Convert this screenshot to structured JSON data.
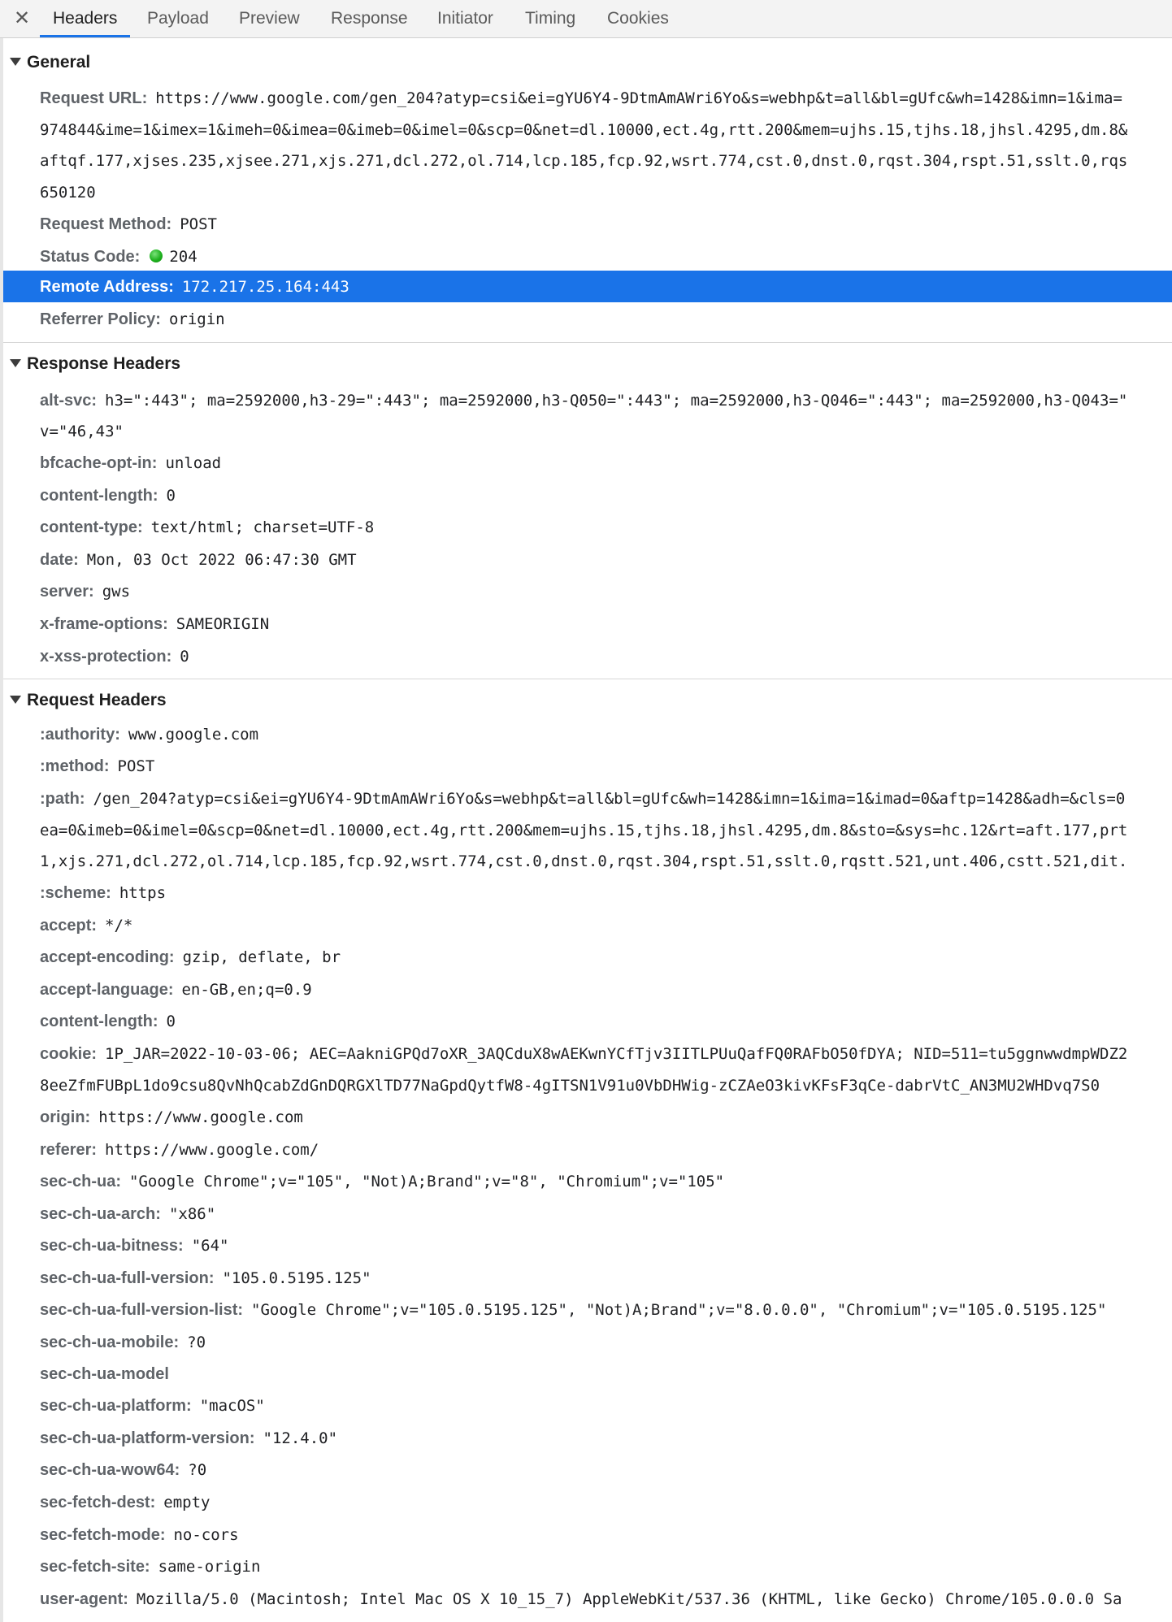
{
  "tabs": {
    "close_icon": "✕",
    "items": [
      "Headers",
      "Payload",
      "Preview",
      "Response",
      "Initiator",
      "Timing",
      "Cookies"
    ],
    "active": "Headers"
  },
  "general": {
    "title": "General",
    "request_url_key": "Request URL:",
    "request_url_lines": [
      "https://www.google.com/gen_204?atyp=csi&ei=gYU6Y4-9DtmAmAWri6Yo&s=webhp&t=all&bl=gUfc&wh=1428&imn=1&ima=",
      "974844&ime=1&imex=1&imeh=0&imea=0&imeb=0&imel=0&scp=0&net=dl.10000,ect.4g,rtt.200&mem=ujhs.15,tjhs.18,jhsl.4295,dm.8&",
      "aftqf.177,xjses.235,xjsee.271,xjs.271,dcl.272,ol.714,lcp.185,fcp.92,wsrt.774,cst.0,dnst.0,rqst.304,rspt.51,sslt.0,rqs",
      "650120"
    ],
    "request_method_key": "Request Method:",
    "request_method": "POST",
    "status_code_key": "Status Code:",
    "status_code": "204",
    "status_color": "#1fb11f",
    "remote_address_key": "Remote Address:",
    "remote_address": "172.217.25.164:443",
    "referrer_policy_key": "Referrer Policy:",
    "referrer_policy": "origin"
  },
  "response_headers": {
    "title": "Response Headers",
    "alt_svc": {
      "key": "alt-svc:",
      "lines": [
        "h3=\":443\"; ma=2592000,h3-29=\":443\"; ma=2592000,h3-Q050=\":443\"; ma=2592000,h3-Q046=\":443\"; ma=2592000,h3-Q043=\"",
        "v=\"46,43\""
      ]
    },
    "items": [
      {
        "key": "bfcache-opt-in:",
        "value": "unload"
      },
      {
        "key": "content-length:",
        "value": "0"
      },
      {
        "key": "content-type:",
        "value": "text/html; charset=UTF-8"
      },
      {
        "key": "date:",
        "value": "Mon, 03 Oct 2022 06:47:30 GMT"
      },
      {
        "key": "server:",
        "value": "gws"
      },
      {
        "key": "x-frame-options:",
        "value": "SAMEORIGIN"
      },
      {
        "key": "x-xss-protection:",
        "value": "0"
      }
    ]
  },
  "request_headers": {
    "title": "Request Headers",
    "authority": {
      "key": ":authority:",
      "value": "www.google.com"
    },
    "method": {
      "key": ":method:",
      "value": "POST"
    },
    "path": {
      "key": ":path:",
      "lines": [
        "/gen_204?atyp=csi&ei=gYU6Y4-9DtmAmAWri6Yo&s=webhp&t=all&bl=gUfc&wh=1428&imn=1&ima=1&imad=0&aftp=1428&adh=&cls=0",
        "ea=0&imeb=0&imel=0&scp=0&net=dl.10000,ect.4g,rtt.200&mem=ujhs.15,tjhs.18,jhsl.4295,dm.8&sto=&sys=hc.12&rt=aft.177,prt",
        "1,xjs.271,dcl.272,ol.714,lcp.185,fcp.92,wsrt.774,cst.0,dnst.0,rqst.304,rspt.51,sslt.0,rqstt.521,unt.406,cstt.521,dit."
      ]
    },
    "scheme": {
      "key": ":scheme:",
      "value": "https"
    },
    "accept": {
      "key": "accept:",
      "value": "*/*"
    },
    "accept_encoding": {
      "key": "accept-encoding:",
      "value": "gzip, deflate, br"
    },
    "accept_language": {
      "key": "accept-language:",
      "value": "en-GB,en;q=0.9"
    },
    "content_length": {
      "key": "content-length:",
      "value": "0"
    },
    "cookie": {
      "key": "cookie:",
      "lines": [
        "1P_JAR=2022-10-03-06; AEC=AakniGPQd7oXR_3AQCduX8wAEKwnYCfTjv3IITLPUuQafFQ0RAFbO50fDYA; NID=511=tu5ggnwwdmpWDZ2",
        "8eeZfmFUBpL1do9csu8QvNhQcabZdGnDQRGXlTD77NaGpdQytfW8-4gITSN1V91u0VbDHWig-zCZAeO3kivKFsF3qCe-dabrVtC_AN3MU2WHDvq7S0"
      ]
    },
    "items": [
      {
        "key": "origin:",
        "value": "https://www.google.com"
      },
      {
        "key": "referer:",
        "value": "https://www.google.com/"
      },
      {
        "key": "sec-ch-ua:",
        "value": "\"Google Chrome\";v=\"105\", \"Not)A;Brand\";v=\"8\", \"Chromium\";v=\"105\""
      },
      {
        "key": "sec-ch-ua-arch:",
        "value": "\"x86\""
      },
      {
        "key": "sec-ch-ua-bitness:",
        "value": "\"64\""
      },
      {
        "key": "sec-ch-ua-full-version:",
        "value": "\"105.0.5195.125\""
      },
      {
        "key": "sec-ch-ua-full-version-list:",
        "value": "\"Google Chrome\";v=\"105.0.5195.125\", \"Not)A;Brand\";v=\"8.0.0.0\", \"Chromium\";v=\"105.0.5195.125\""
      },
      {
        "key": "sec-ch-ua-mobile:",
        "value": "?0"
      },
      {
        "key": "sec-ch-ua-model",
        "value": ""
      },
      {
        "key": "sec-ch-ua-platform:",
        "value": "\"macOS\""
      },
      {
        "key": "sec-ch-ua-platform-version:",
        "value": "\"12.4.0\""
      },
      {
        "key": "sec-ch-ua-wow64:",
        "value": "?0"
      },
      {
        "key": "sec-fetch-dest:",
        "value": "empty"
      },
      {
        "key": "sec-fetch-mode:",
        "value": "no-cors"
      },
      {
        "key": "sec-fetch-site:",
        "value": "same-origin"
      },
      {
        "key": "user-agent:",
        "value": "Mozilla/5.0 (Macintosh; Intel Mac OS X 10_15_7) AppleWebKit/537.36 (KHTML, like Gecko) Chrome/105.0.0.0 Sa"
      }
    ]
  }
}
